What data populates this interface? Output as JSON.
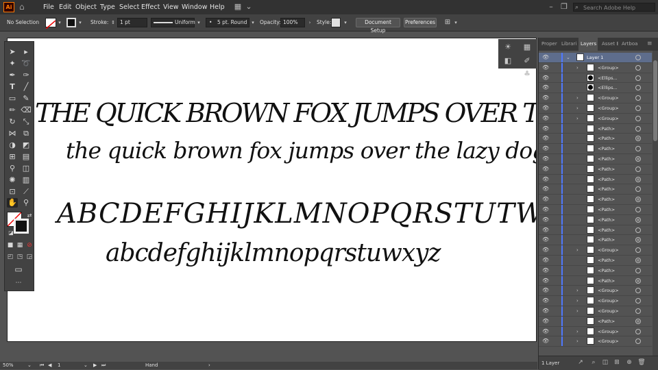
{
  "menu": {
    "app_logo": "Ai",
    "items": [
      "File",
      "Edit",
      "Object",
      "Type",
      "Select",
      "Effect",
      "View",
      "Window",
      "Help"
    ],
    "search_placeholder": "Search Adobe Help"
  },
  "control_bar": {
    "selection_label": "No Selection",
    "stroke_label": "Stroke:",
    "stroke_value": "1 pt",
    "profile_label": "Uniform",
    "brush_label": "5 pt. Round",
    "opacity_label": "Opacity:",
    "opacity_value": "100%",
    "style_label": "Style:",
    "doc_setup_label": "Document Setup",
    "preferences_label": "Preferences"
  },
  "artboard": {
    "line1": "THE QUICK BROWN FOX JUMPS OVER THE LAZY DOGS",
    "line2": "the quick brown fox jumps over the lazy dogs",
    "line3": "ABCDEFGHIJKLMNOPQRSTUTWXYZ",
    "line4": "abcdefghijklmnopqrstuwxyz"
  },
  "panel": {
    "tabs": [
      "Proper",
      "Librari",
      "Layers",
      "Asset E",
      "Artboa"
    ],
    "active_tab": "Layers",
    "layer_count": "1 Layer",
    "rows": [
      {
        "name": "Layer 1",
        "type": "layer"
      },
      {
        "name": "<Group>",
        "type": "group"
      },
      {
        "name": "<Ellips...",
        "type": "ellipse"
      },
      {
        "name": "<Ellips...",
        "type": "ellipse"
      },
      {
        "name": "<Group>",
        "type": "group"
      },
      {
        "name": "<Group>",
        "type": "group"
      },
      {
        "name": "<Group>",
        "type": "group"
      },
      {
        "name": "<Path>",
        "type": "path"
      },
      {
        "name": "<Path>",
        "type": "path"
      },
      {
        "name": "<Path>",
        "type": "path"
      },
      {
        "name": "<Path>",
        "type": "path"
      },
      {
        "name": "<Path>",
        "type": "path"
      },
      {
        "name": "<Path>",
        "type": "path"
      },
      {
        "name": "<Path>",
        "type": "path"
      },
      {
        "name": "<Path>",
        "type": "path"
      },
      {
        "name": "<Path>",
        "type": "path"
      },
      {
        "name": "<Path>",
        "type": "path"
      },
      {
        "name": "<Path>",
        "type": "path"
      },
      {
        "name": "<Path>",
        "type": "path"
      },
      {
        "name": "<Group>",
        "type": "group"
      },
      {
        "name": "<Path>",
        "type": "path"
      },
      {
        "name": "<Path>",
        "type": "path"
      },
      {
        "name": "<Path>",
        "type": "path"
      },
      {
        "name": "<Group>",
        "type": "group"
      },
      {
        "name": "<Group>",
        "type": "group"
      },
      {
        "name": "<Group>",
        "type": "group"
      },
      {
        "name": "<Path>",
        "type": "path"
      },
      {
        "name": "<Group>",
        "type": "group"
      },
      {
        "name": "<Group>",
        "type": "group"
      }
    ]
  },
  "status": {
    "zoom": "50%",
    "page": "1",
    "tool": "Hand"
  },
  "colors": {
    "accent": "#ff7c00",
    "layer_color": "#4f79ff",
    "canvas_bg": "#535353"
  }
}
